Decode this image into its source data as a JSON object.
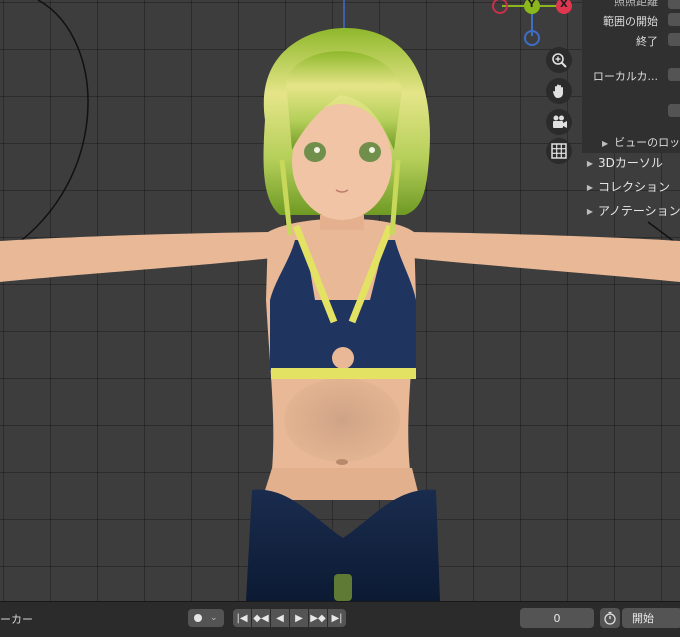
{
  "gizmo": {
    "y_axis": "Y",
    "x_axis": "X"
  },
  "nav_buttons": [
    {
      "icon": "zoom-icon"
    },
    {
      "icon": "hand-pan-icon"
    },
    {
      "icon": "camera-icon"
    },
    {
      "icon": "grid-icon"
    }
  ],
  "sidebar": {
    "clip_start_partial": "照照距離",
    "range_start": "範囲の開始",
    "range_end": "終了",
    "local_camera": "ローカルカ...",
    "view_lock": "ビューのロッ",
    "sections": [
      "3Dカーソル",
      "コレクション",
      "アノテーション"
    ]
  },
  "timeline": {
    "marker_menu": "ーカー",
    "current_frame": "0",
    "start_label": "開始"
  },
  "colors": {
    "viewport_bg": "#3d3d3d",
    "grid_line": "#2f2f2f",
    "y_axis": "#3e6dc8",
    "gizmo_y": "#8ab81c",
    "gizmo_x": "#e0364f",
    "hair": "#a9c53a",
    "skin": "#e9b896",
    "top": "#1f3560",
    "trim": "#e3e262"
  }
}
